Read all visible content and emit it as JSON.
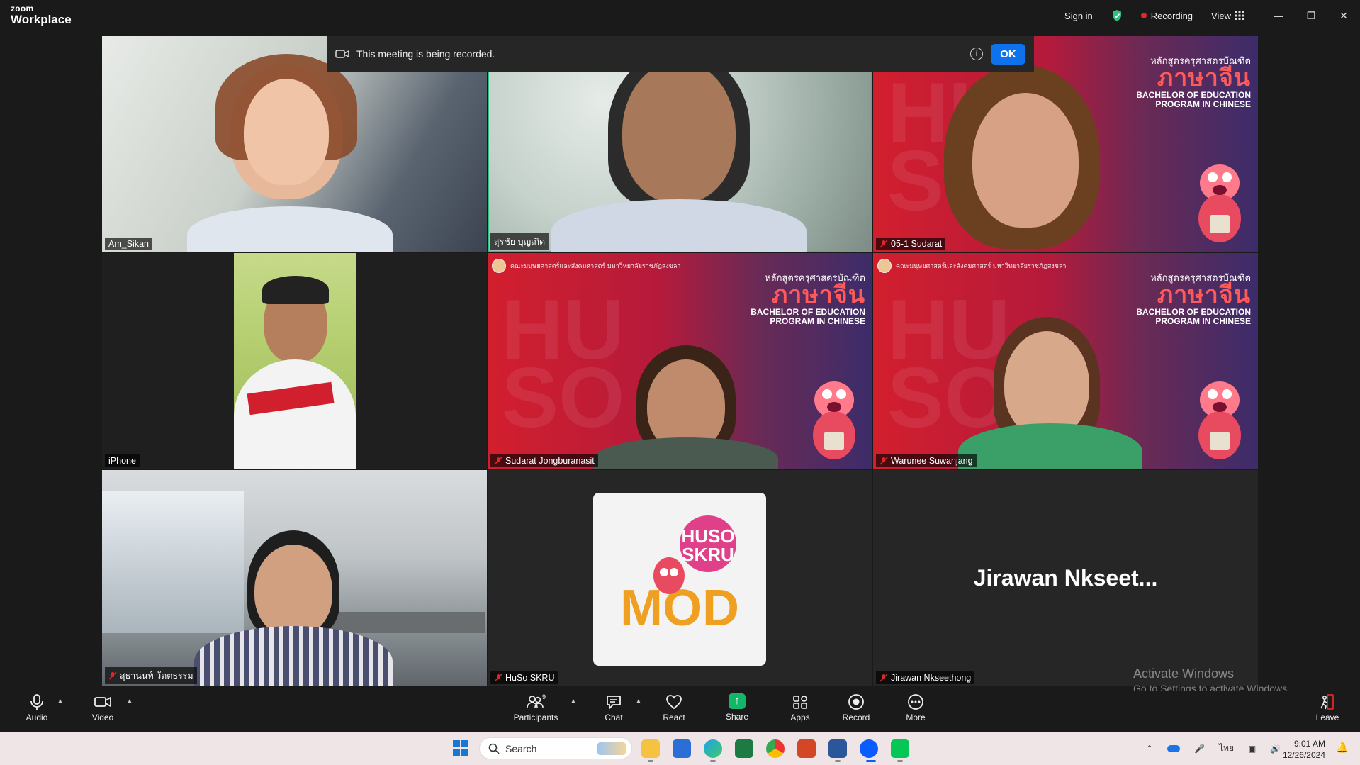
{
  "titlebar": {
    "logo_top": "zoom",
    "logo_bottom": "Workplace",
    "sign_in": "Sign in",
    "recording": "Recording",
    "view": "View"
  },
  "banner": {
    "message": "This meeting is being recorded.",
    "ok": "OK"
  },
  "tiles": [
    {
      "name": "Am_Sikan",
      "muted": false
    },
    {
      "name": "สุรชัย บุญเกิด",
      "muted": false,
      "active_speaker": true
    },
    {
      "name": "05-1 Sudarat",
      "muted": true
    },
    {
      "name": "iPhone",
      "muted": false
    },
    {
      "name": "Sudarat Jongburanasit",
      "muted": true
    },
    {
      "name": "Warunee Suwanjang",
      "muted": true
    },
    {
      "name": "สุธานนท์ วัตตธรรม",
      "muted": true
    },
    {
      "name": "HuSo SKRU",
      "muted": true
    },
    {
      "name": "Jirawan Nkseethong",
      "muted": true,
      "display_name": "Jirawan  Nkseet..."
    }
  ],
  "huso_bg": {
    "header": "คณะมนุษยศาสตร์และสังคมศาสตร์ มหาวิทยาลัยราชภัฏสงขลา",
    "thai_small": "หลักสูตรครุศาสตรบัณฑิต",
    "thai_big": "ภาษาจีน",
    "eng1": "BACHELOR OF EDUCATION",
    "eng2": "PROGRAM IN CHINESE"
  },
  "avatar_card": {
    "line1": "HUSO",
    "line2": "SKRU",
    "word": "MOD"
  },
  "activate": {
    "title": "Activate Windows",
    "subtitle": "Go to Settings to activate Windows."
  },
  "toolbar": {
    "audio": "Audio",
    "video": "Video",
    "participants": "Participants",
    "participants_count": "9",
    "chat": "Chat",
    "react": "React",
    "share": "Share",
    "apps": "Apps",
    "record": "Record",
    "more": "More",
    "leave": "Leave"
  },
  "taskbar": {
    "search_placeholder": "Search",
    "time": "9:01 AM",
    "date": "12/26/2024",
    "lang": "ไทย"
  },
  "colors": {
    "accent_blue": "#0e72ed",
    "share_green": "#12b76a",
    "speaker_outline": "#2ec27e",
    "record_red": "#e02828"
  }
}
